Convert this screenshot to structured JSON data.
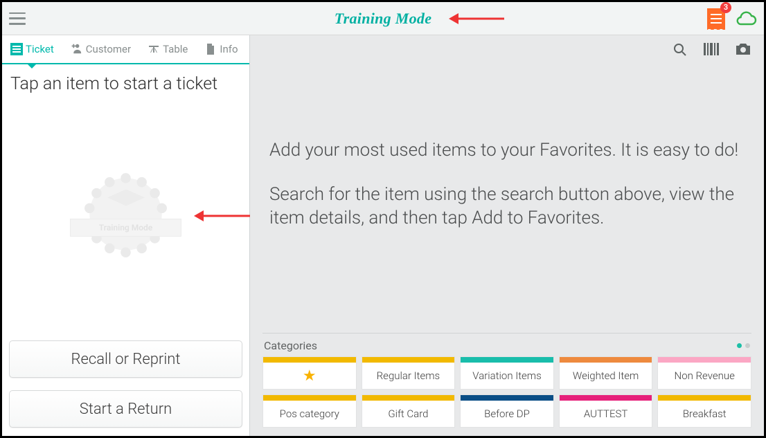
{
  "header": {
    "title": "Training Mode",
    "notifications_count": "3"
  },
  "tabs": [
    {
      "label": "Ticket"
    },
    {
      "label": "Customer"
    },
    {
      "label": "Table"
    },
    {
      "label": "Info"
    }
  ],
  "ticket_prompt": "Tap an item to start a ticket",
  "training_badge_label": "Training Mode",
  "buttons": {
    "recall": "Recall or Reprint",
    "return": "Start a Return"
  },
  "favorites_help": {
    "p1": "Add your most used items to your Favorites. It is easy to do!",
    "p2": "Search for the item using the search button above, view the item details, and then tap Add to Favorites."
  },
  "categories_label": "Categories",
  "categories": [
    {
      "label": "★",
      "color": "#f2b900",
      "star": true
    },
    {
      "label": "Regular Items",
      "color": "#f2b900"
    },
    {
      "label": "Variation Items",
      "color": "#19bdab"
    },
    {
      "label": "Weighted Item",
      "color": "#ee8a3e"
    },
    {
      "label": "Non Revenue",
      "color": "#fba7c4"
    },
    {
      "label": "Pos category",
      "color": "#f2b900"
    },
    {
      "label": "Gift Card",
      "color": "#f2b900"
    },
    {
      "label": "Before DP",
      "color": "#0a4e86"
    },
    {
      "label": "AUTTEST",
      "color": "#e6207a"
    },
    {
      "label": "Breakfast",
      "color": "#f2b900"
    }
  ]
}
